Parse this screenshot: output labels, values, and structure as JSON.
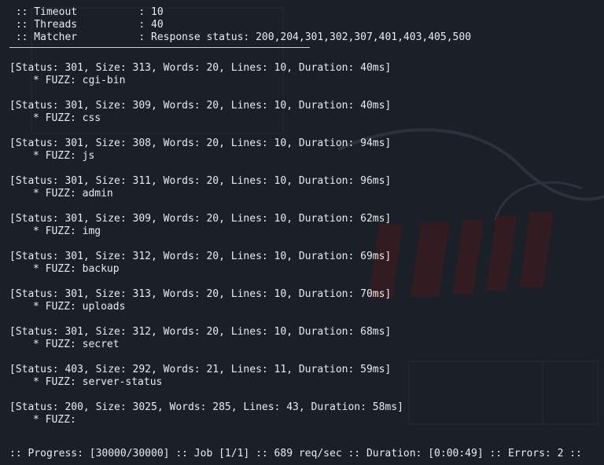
{
  "config": [
    {
      "label": " :: Timeout          ",
      "sep": ": ",
      "value": "10"
    },
    {
      "label": " :: Threads          ",
      "sep": ": ",
      "value": "40"
    },
    {
      "label": " :: Matcher          ",
      "sep": ": ",
      "value": "Response status: 200,204,301,302,307,401,403,405,500"
    }
  ],
  "results": [
    {
      "status_line": "[Status: 301, Size: 313, Words: 20, Lines: 10, Duration: 40ms]",
      "fuzz": "* FUZZ: cgi-bin"
    },
    {
      "status_line": "[Status: 301, Size: 309, Words: 20, Lines: 10, Duration: 40ms]",
      "fuzz": "* FUZZ: css"
    },
    {
      "status_line": "[Status: 301, Size: 308, Words: 20, Lines: 10, Duration: 94ms]",
      "fuzz": "* FUZZ: js"
    },
    {
      "status_line": "[Status: 301, Size: 311, Words: 20, Lines: 10, Duration: 96ms]",
      "fuzz": "* FUZZ: admin"
    },
    {
      "status_line": "[Status: 301, Size: 309, Words: 20, Lines: 10, Duration: 62ms]",
      "fuzz": "* FUZZ: img"
    },
    {
      "status_line": "[Status: 301, Size: 312, Words: 20, Lines: 10, Duration: 69ms]",
      "fuzz": "* FUZZ: backup"
    },
    {
      "status_line": "[Status: 301, Size: 313, Words: 20, Lines: 10, Duration: 70ms]",
      "fuzz": "* FUZZ: uploads"
    },
    {
      "status_line": "[Status: 301, Size: 312, Words: 20, Lines: 10, Duration: 68ms]",
      "fuzz": "* FUZZ: secret"
    },
    {
      "status_line": "[Status: 403, Size: 292, Words: 21, Lines: 11, Duration: 59ms]",
      "fuzz": "* FUZZ: server-status"
    },
    {
      "status_line": "[Status: 200, Size: 3025, Words: 285, Lines: 43, Duration: 58ms]",
      "fuzz": "* FUZZ: "
    }
  ],
  "progress": ":: Progress: [30000/30000] :: Job [1/1] :: 689 req/sec :: Duration: [0:00:49] :: Errors: 2 ::",
  "colors": {
    "background": "#1b1f27",
    "text": "#e9ecef",
    "wallpaper_accent": "#5a1c22"
  }
}
